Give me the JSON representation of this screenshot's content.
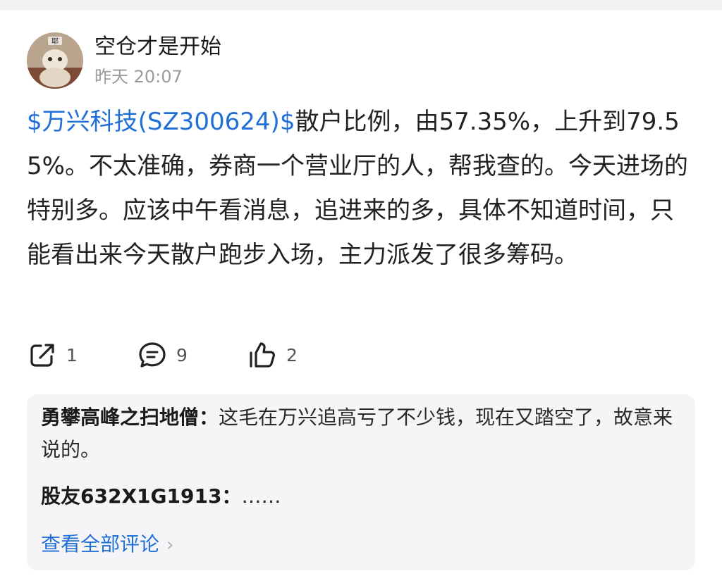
{
  "post": {
    "author": {
      "name": "空仓才是开始",
      "avatar_badge": "耶"
    },
    "time": "昨天 20:07",
    "stock_tag": "$万兴科技(SZ300624)$",
    "content_text": "散户比例，由57.35%，上升到79.55%。不太准确，券商一个营业厅的人，帮我查的。今天进场的特别多。应该中午看消息，追进来的多，具体不知道时间，只能看出来今天散户跑步入场，主力派发了很多筹码。",
    "actions": {
      "share": {
        "icon": "share-icon",
        "count": "1"
      },
      "comment": {
        "icon": "comment-icon",
        "count": "9"
      },
      "like": {
        "icon": "thumbs-up-icon",
        "count": "2"
      }
    }
  },
  "comments": {
    "items": [
      {
        "name": "勇攀高峰之扫地僧：",
        "text": "这毛在万兴追高亏了不少钱，现在又踏空了，故意来说的。"
      },
      {
        "name": "股友632X1G1913：",
        "text": "……"
      }
    ],
    "view_all": "查看全部评论",
    "view_all_icon": "chevron-right-icon"
  },
  "colors": {
    "link": "#1f6fd6",
    "text": "#222222",
    "muted": "#9a9a9a",
    "comment_bg": "#f5f5f7"
  }
}
